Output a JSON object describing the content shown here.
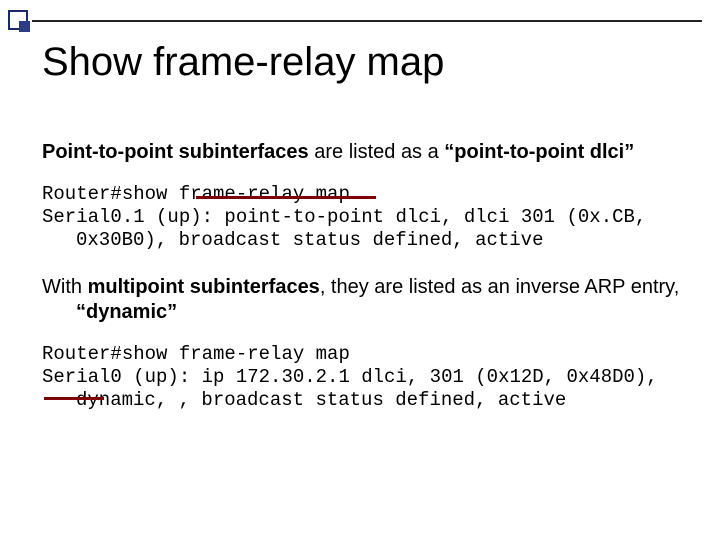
{
  "title": "Show frame-relay map",
  "p1": {
    "pre": "Point-to-point subinterfaces",
    "mid": " are listed as a ",
    "post": "“point-to-point dlci”"
  },
  "code1": {
    "l1": "Router#show frame-relay map",
    "l2": "Serial0.1 (up): point-to-point dlci, dlci 301 (0x.CB, 0x30B0), broadcast status defined, active"
  },
  "p2": {
    "pre": "With ",
    "bold": "multipoint subinterfaces",
    "mid": ", they are listed as an inverse ARP entry, ",
    "post": "“dynamic”"
  },
  "code2": {
    "l1": "Router#show frame-relay map",
    "l2": "Serial0 (up): ip 172.30.2.1 dlci, 301 (0x12D, 0x48D0), dynamic, , broadcast status defined, active"
  }
}
